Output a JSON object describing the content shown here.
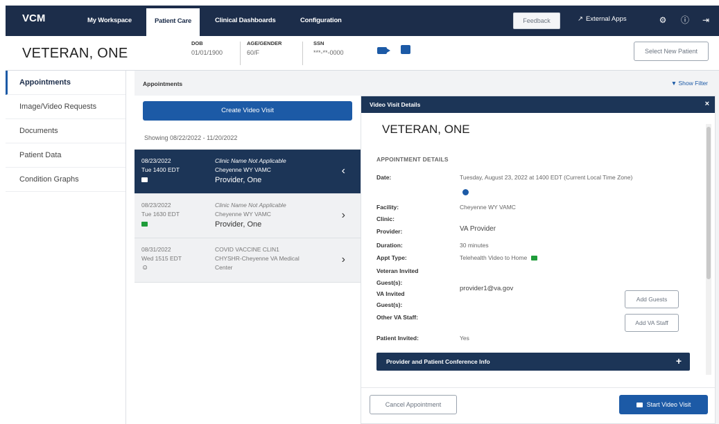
{
  "nav": {
    "brand": "VCM",
    "tabs": [
      {
        "label": "My Workspace"
      },
      {
        "label": "Patient Care"
      },
      {
        "label": "Clinical Dashboards"
      },
      {
        "label": "Configuration"
      }
    ],
    "feedback": "Feedback",
    "external_apps": "External Apps",
    "icons": [
      "gear-icon",
      "help-icon",
      "logout-icon"
    ]
  },
  "patient": {
    "name": "VETERAN, ONE",
    "dob_label": "DOB",
    "dob": "01/01/1900",
    "age_gender_label": "AGE/GENDER",
    "age_gender": "60/F",
    "ssn_label": "SSN",
    "ssn": "***-**-0000",
    "select_new": "Select New Patient"
  },
  "sidebar": {
    "items": [
      {
        "label": "Appointments"
      },
      {
        "label": "Image/Video Requests"
      },
      {
        "label": "Documents"
      },
      {
        "label": "Patient Data"
      },
      {
        "label": "Condition Graphs"
      }
    ]
  },
  "appointments": {
    "title": "Appointments",
    "show_filter": "Show Filter",
    "create_button": "Create Video Visit",
    "showing": "Showing 08/22/2022 - 11/20/2022",
    "rows": [
      {
        "date": "08/23/2022",
        "time": "Tue 1400 EDT",
        "clinic": "Clinic Name Not Applicable",
        "facility": "Cheyenne WY VAMC",
        "provider": "Provider, One"
      },
      {
        "date": "08/23/2022",
        "time": "Tue 1630 EDT",
        "clinic": "Clinic Name Not Applicable",
        "facility": "Cheyenne WY VAMC",
        "provider": "Provider, One"
      },
      {
        "date": "08/31/2022",
        "time": "Wed 1515 EDT",
        "clinic": "COVID VACCINE CLIN1",
        "facility": "CHYSHR-Cheyenne VA Medical",
        "provider": "Center"
      }
    ]
  },
  "details": {
    "title": "Video Visit Details",
    "name": "VETERAN, ONE",
    "section": "APPOINTMENT DETAILS",
    "date_label": "Date:",
    "date_value": "Tuesday, August 23, 2022 at 1400 EDT (Current Local Time Zone)",
    "facility_label": "Facility:",
    "facility_value": "Cheyenne WY VAMC",
    "clinic_label": "Clinic:",
    "provider_label": "Provider:",
    "provider_value": "VA Provider",
    "duration_label": "Duration:",
    "duration_value": "30 minutes",
    "type_label": "Appt Type:",
    "type_value": "Telehealth Video to Home",
    "veteran_guests_label": "Veteran Invited",
    "guests_label": "Guest(s):",
    "va_guests_label": "VA Invited",
    "va_guests_label2": "Guest(s):",
    "va_guest_value": "provider1@va.gov",
    "other_staff_label": "Other VA Staff:",
    "patient_invited_label": "Patient Invited:",
    "patient_invited_value": "Yes",
    "add_guests": "Add Guests",
    "add_staff": "Add VA Staff",
    "conference": "Provider and Patient Conference Info",
    "cancel": "Cancel Appointment",
    "start": "Start Video Visit"
  }
}
